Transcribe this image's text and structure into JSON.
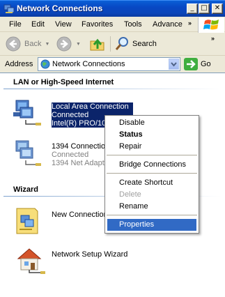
{
  "window": {
    "title": "Network Connections",
    "controls": {
      "minimize": "_",
      "maximize": "□",
      "close": "✕"
    }
  },
  "menubar": {
    "items": [
      "File",
      "Edit",
      "View",
      "Favorites",
      "Tools",
      "Advance"
    ],
    "overflow": "»"
  },
  "toolbar": {
    "back_label": "Back",
    "search_label": "Search",
    "overflow": "»"
  },
  "addressbar": {
    "label": "Address",
    "value": "Network Connections",
    "go_label": "Go"
  },
  "groups": [
    {
      "heading": "LAN or High-Speed Internet"
    },
    {
      "heading": "Wizard"
    }
  ],
  "items": {
    "lan": {
      "name": "Local Area Connection",
      "status": "Connected",
      "device": "Intel(R) PRO/10"
    },
    "n1394": {
      "name": "1394 Connection",
      "status": "Connected",
      "device": "1394 Net Adapt"
    },
    "new_connection": {
      "name": "New Connection"
    },
    "setup_wizard": {
      "name": "Network Setup Wizard"
    }
  },
  "context_menu": {
    "items": [
      {
        "label": "Disable",
        "style": "normal"
      },
      {
        "label": "Status",
        "style": "bold"
      },
      {
        "label": "Repair",
        "style": "normal"
      },
      {
        "label": "Bridge Connections",
        "style": "normal"
      },
      {
        "label": "Create Shortcut",
        "style": "normal"
      },
      {
        "label": "Delete",
        "style": "disabled"
      },
      {
        "label": "Rename",
        "style": "normal"
      },
      {
        "label": "Properties",
        "style": "highlighted"
      }
    ]
  },
  "colors": {
    "titlebar": "#0a5fd6",
    "selection": "#0b246a",
    "menu_highlight": "#316ac5",
    "window_face": "#ece9d8"
  }
}
